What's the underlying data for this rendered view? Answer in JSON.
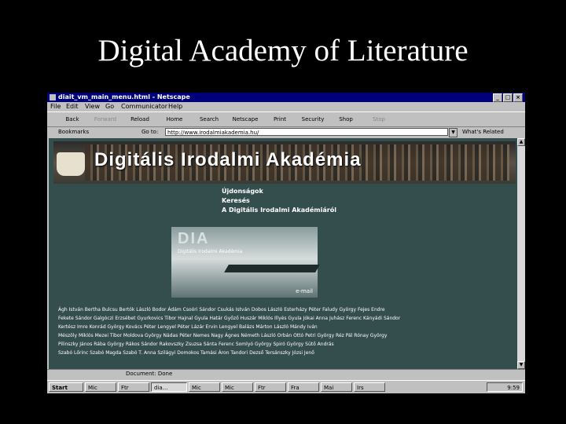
{
  "slide": {
    "title": "Digital Academy of Literature"
  },
  "window": {
    "title": "diait_vm_main_menu.html - Netscape"
  },
  "menu": [
    "File",
    "Edit",
    "View",
    "Go",
    "Communicator",
    "Help"
  ],
  "toolbar": [
    "Back",
    "Forward",
    "Reload",
    "Home",
    "Search",
    "Netscape",
    "Print",
    "Security",
    "Shop",
    "Stop"
  ],
  "location": {
    "bookmarks": "Bookmarks",
    "label": "Go to:",
    "url": "http://www.irodalmiakademia.hu/",
    "whats_related": "What's Related"
  },
  "page": {
    "banner": "Digitális Irodalmi Akadémia",
    "links": [
      "Újdonságok",
      "Keresés",
      "A Digitális Irodalmi Akadémiáról"
    ],
    "logo": "DIA",
    "logo_sub": "Digitális Irodalmi Akadémia",
    "email": "e-mail",
    "authors": [
      "Ágh István   Bertha Bulcsu   Bertók László   Bodor Ádám   Csoóri Sándor   Csukás István   Dobos László   Esterházy Péter   Faludy György   Fejes Endre",
      "Fekete Sándor   Galgóczi Erzsébet   Gyurkovics Tibor   Hajnal Gyula   Határ Győző   Huszár Miklós   Illyés Gyula   Jókai Anna   Juhász Ferenc   Kányádi Sándor",
      "Kertész Imre   Konrád György   Kovács Péter   Lengyel Péter   Lázár Ervin   Lengyel Balázs   Márton László   Mándy Iván",
      "Mészöly Miklós   Mezei Tibor   Moldova György   Nádas Péter   Nemes Nagy Ágnes   Németh László   Orbán Ottó   Petri György   Réz Pál   Rónay György",
      "Pilinszky János   Rába György   Rákos Sándor   Rakovszky Zsuzsa   Sánta Ferenc   Somlyó György   Spiró György   Sütő András",
      "Szabó Lőrinc   Szabó Magda   Szabó T. Anna   Szilágyi Domokos   Tamási Áron   Tandori Dezső   Tersánszky Józsi Jenő"
    ]
  },
  "status": "Document: Done",
  "taskbar": {
    "items": [
      "Start",
      "Mic",
      "Ftr",
      "dia...",
      "Mic",
      "Mic",
      "Ftr",
      "Fra",
      "Mai",
      "Irs"
    ],
    "clock": "9:59"
  }
}
